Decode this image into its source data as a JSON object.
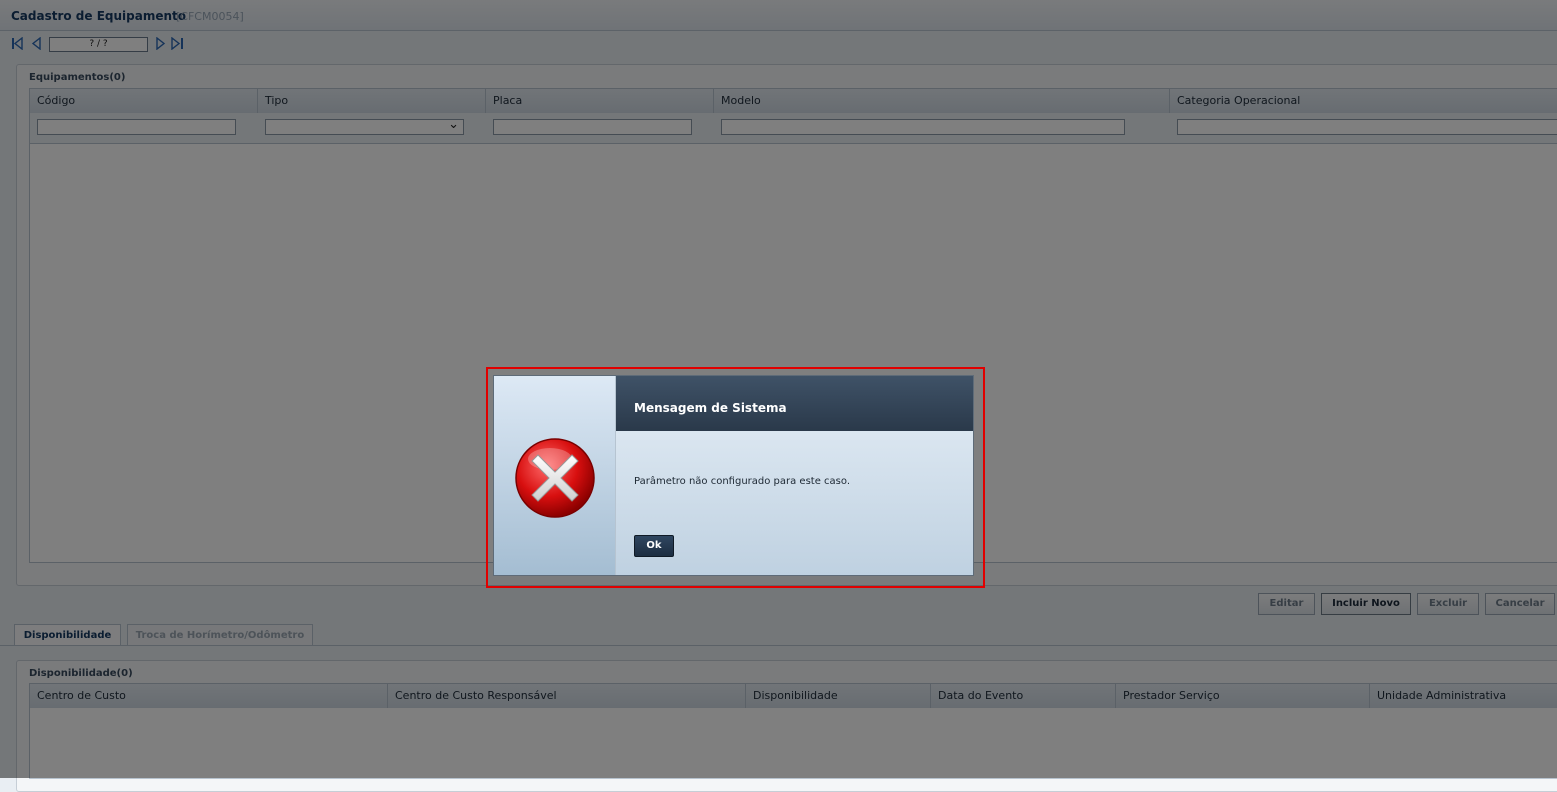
{
  "header": {
    "title": "Cadastro de Equipamento",
    "code": "[CFCM0054]"
  },
  "toolbar": {
    "first_icon": "first-page-icon",
    "prev_icon": "prev-page-icon",
    "next_icon": "next-page-icon",
    "last_icon": "last-page-icon",
    "pager": "? / ?"
  },
  "equipamentos": {
    "label": "Equipamentos(0)",
    "columns": [
      "Código",
      "Tipo",
      "Placa",
      "Modelo",
      "Categoria Operacional"
    ]
  },
  "actions": {
    "edit": "Editar",
    "new": "Incluir Novo",
    "delete": "Excluir",
    "cancel": "Cancelar"
  },
  "tabs": [
    {
      "label": "Disponibilidade",
      "active": true
    },
    {
      "label": "Troca de Horímetro/Odômetro",
      "active": false
    }
  ],
  "disponibilidade": {
    "label": "Disponibilidade(0)",
    "columns": [
      "Centro de Custo",
      "Centro de Custo Responsável",
      "Disponibilidade",
      "Data do Evento",
      "Prestador Serviço",
      "Unidade Administrativa"
    ]
  },
  "dialog": {
    "icon": "error-icon",
    "title": "Mensagem de Sistema",
    "message": "Parâmetro não configurado para este caso.",
    "ok_label": "Ok"
  },
  "colors": {
    "accent": "#163a63",
    "dialog_header": "#34475b",
    "highlight": "#e10000"
  }
}
